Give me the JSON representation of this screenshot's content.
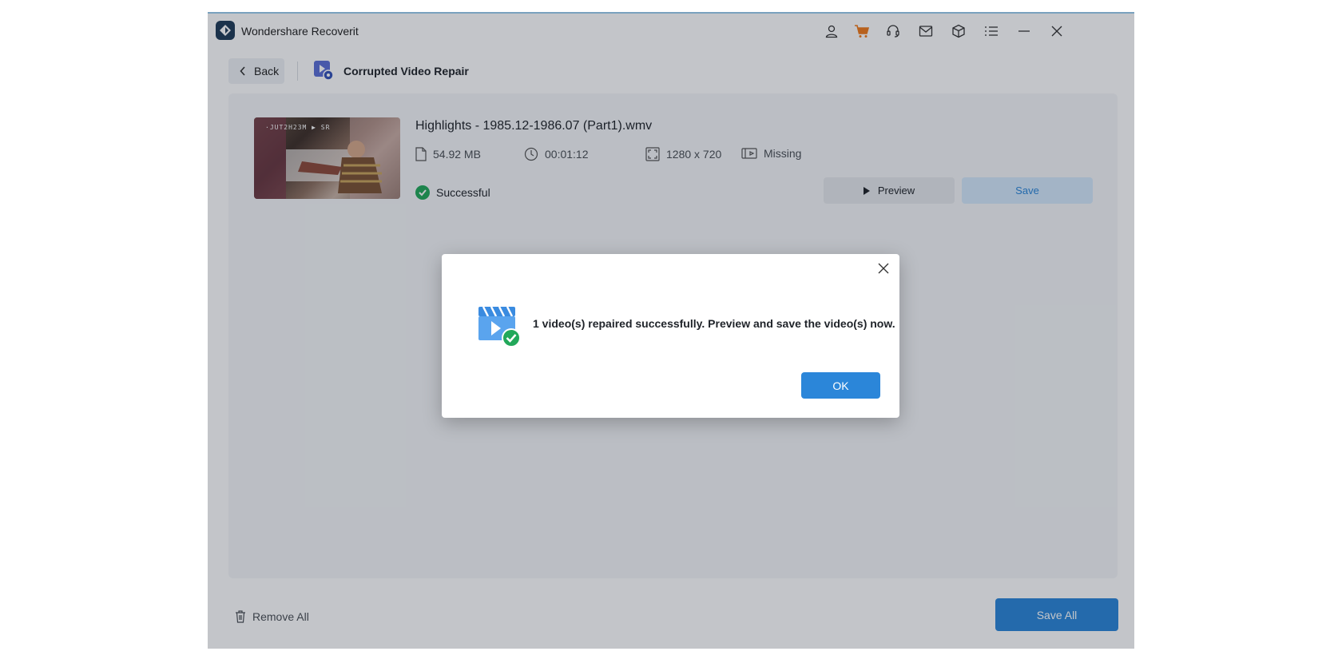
{
  "app": {
    "title": "Wondershare Recoverit"
  },
  "titlebar": {
    "icons": [
      "account-icon",
      "cart-icon",
      "support-icon",
      "mail-icon",
      "box-icon",
      "menu-icon",
      "minimize-icon",
      "close-icon"
    ]
  },
  "subbar": {
    "back_label": "Back",
    "module_title": "Corrupted Video Repair"
  },
  "video": {
    "thumb_osd": "·JUT2H23M  ▶  SR",
    "filename": "Highlights - 1985.12-1986.07 (Part1).wmv",
    "size": "54.92  MB",
    "duration": "00:01:12",
    "resolution": "1280 x 720",
    "audio": "Missing",
    "status": "Successful",
    "preview_label": "Preview",
    "save_label": "Save"
  },
  "footer": {
    "remove_all_label": "Remove All",
    "save_all_label": "Save All"
  },
  "dialog": {
    "message": "1 video(s) repaired successfully. Preview and save the video(s) now.",
    "ok_label": "OK"
  },
  "colors": {
    "accent": "#2b86d9",
    "success": "#22a85a",
    "cart": "#f07a1a",
    "save_secondary_bg": "#d4e9fb"
  }
}
